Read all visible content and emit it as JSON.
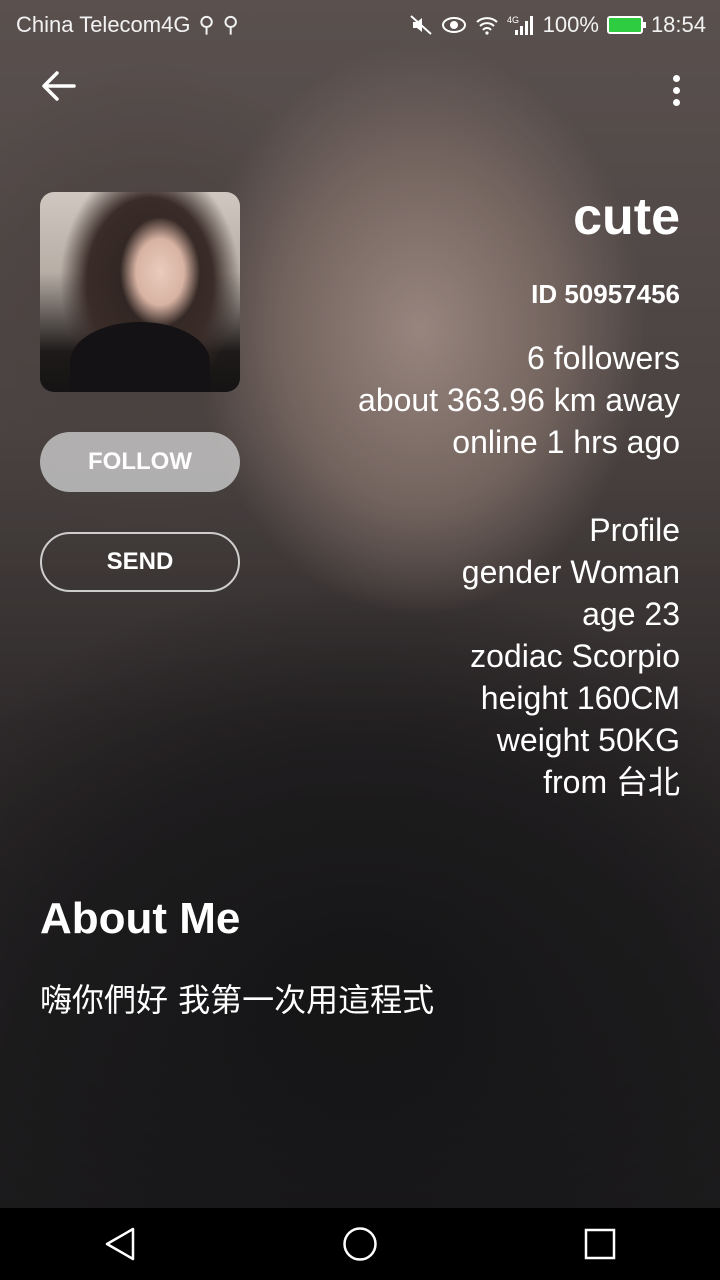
{
  "status_bar": {
    "carrier": "China Telecom4G",
    "battery": "100%",
    "time": "18:54",
    "icons": [
      "usb-icon",
      "usb-icon",
      "mute-icon",
      "eye-icon",
      "wifi-icon",
      "signal-icon",
      "battery-icon"
    ]
  },
  "toolbar": {
    "back_icon": "arrow-left-icon",
    "more_icon": "more-vertical-icon"
  },
  "profile_header": {
    "nickname": "cute",
    "user_id": "ID 50957456",
    "followers": "6 followers",
    "distance": "about 363.96 km away",
    "last_online": "online 1 hrs ago"
  },
  "actions": {
    "follow_label": "FOLLOW",
    "send_label": "SEND"
  },
  "profile": {
    "title": "Profile",
    "gender": "gender Woman",
    "age": "age 23",
    "zodiac": "zodiac Scorpio",
    "height": "height 160CM",
    "weight": "weight 50KG",
    "from": "from 台北"
  },
  "about": {
    "title": "About Me",
    "text": "嗨你們好 我第一次用這程式"
  },
  "nav_bar": {
    "buttons": [
      "back-triangle-icon",
      "home-circle-icon",
      "recents-square-icon"
    ]
  },
  "colors": {
    "follow_bg": "#c8c8c8",
    "battery_fill": "#2ecc40"
  }
}
